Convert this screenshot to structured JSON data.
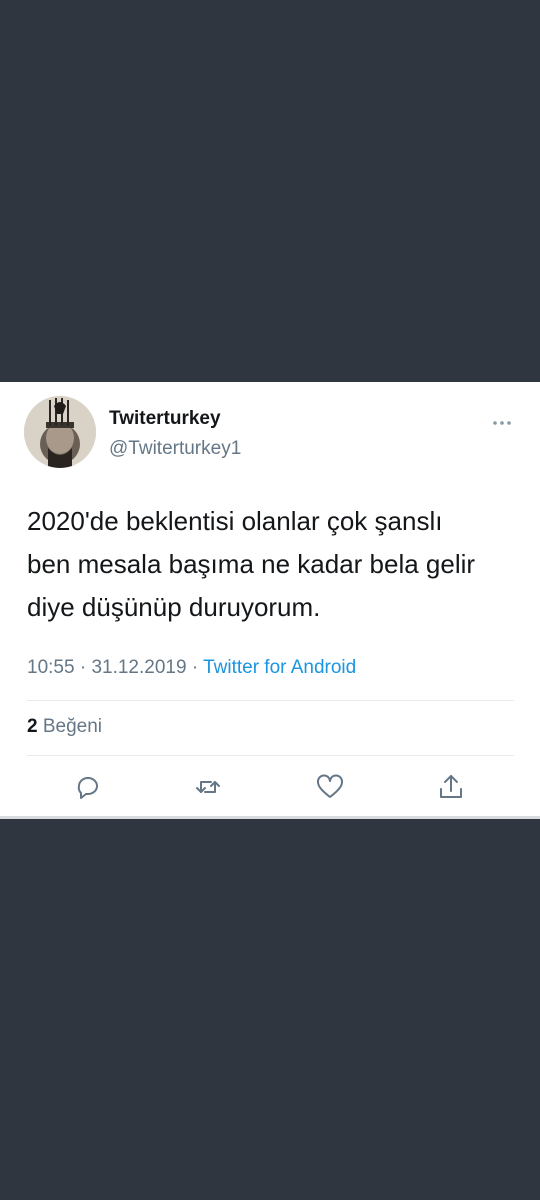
{
  "tweet": {
    "display_name": "Twiterturkey",
    "handle": "@Twiterturkey1",
    "text_lines": [
      "2020'de beklentisi olanlar çok şanslı",
      "ben mesala başıma ne kadar bela gelir",
      "diye düşünüp duruyorum."
    ],
    "time": "10:55",
    "separator": "·",
    "date": "31.12.2019",
    "source": "Twitter for Android",
    "likes_count": "2",
    "likes_label": "Beğeni"
  },
  "icons": {
    "more": "more-horizontal-icon",
    "reply": "reply-icon",
    "retweet": "retweet-icon",
    "like": "heart-icon",
    "share": "share-icon"
  },
  "colors": {
    "background": "#2f3640",
    "card": "#ffffff",
    "text": "#14171a",
    "secondary": "#657786",
    "link": "#1b95e0"
  }
}
